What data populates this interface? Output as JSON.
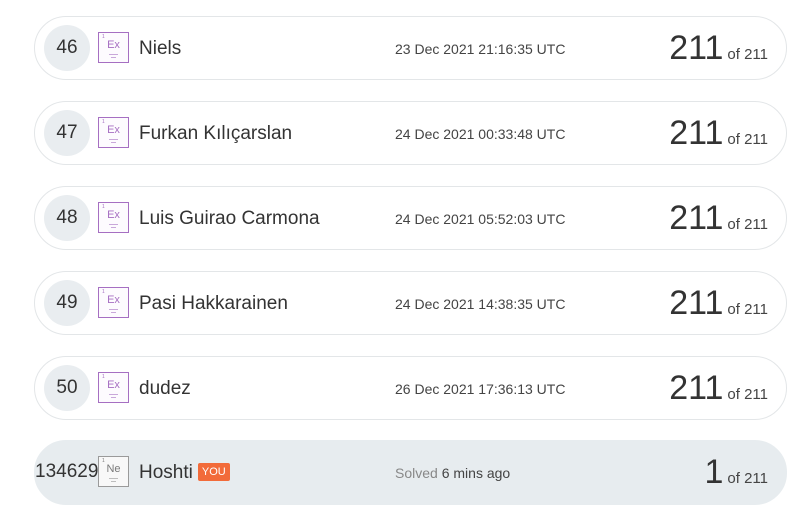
{
  "rows": [
    {
      "rank": "46",
      "element_symbol": "Ex",
      "name": "Niels",
      "date": "23 Dec 2021 21:16:35 UTC",
      "score": "211",
      "total": "of 211"
    },
    {
      "rank": "47",
      "element_symbol": "Ex",
      "name": "Furkan Kılıçarslan",
      "date": "24 Dec 2021 00:33:48 UTC",
      "score": "211",
      "total": "of 211"
    },
    {
      "rank": "48",
      "element_symbol": "Ex",
      "name": "Luis Guirao Carmona",
      "date": "24 Dec 2021 05:52:03 UTC",
      "score": "211",
      "total": "of 211"
    },
    {
      "rank": "49",
      "element_symbol": "Ex",
      "name": "Pasi Hakkarainen",
      "date": "24 Dec 2021 14:38:35 UTC",
      "score": "211",
      "total": "of 211"
    },
    {
      "rank": "50",
      "element_symbol": "Ex",
      "name": "dudez",
      "date": "26 Dec 2021 17:36:13 UTC",
      "score": "211",
      "total": "of 211"
    }
  ],
  "current_user": {
    "rank": "134629",
    "element_symbol": "Ne",
    "name": "Hoshti",
    "you_badge": "YOU",
    "solved_label": "Solved",
    "solved_time": "6 mins ago",
    "score": "1",
    "total": "of 211"
  },
  "colors": {
    "badge_purple": "#a66fc2",
    "you_badge": "#f26b3a",
    "current_row_bg": "#e7ecef"
  }
}
